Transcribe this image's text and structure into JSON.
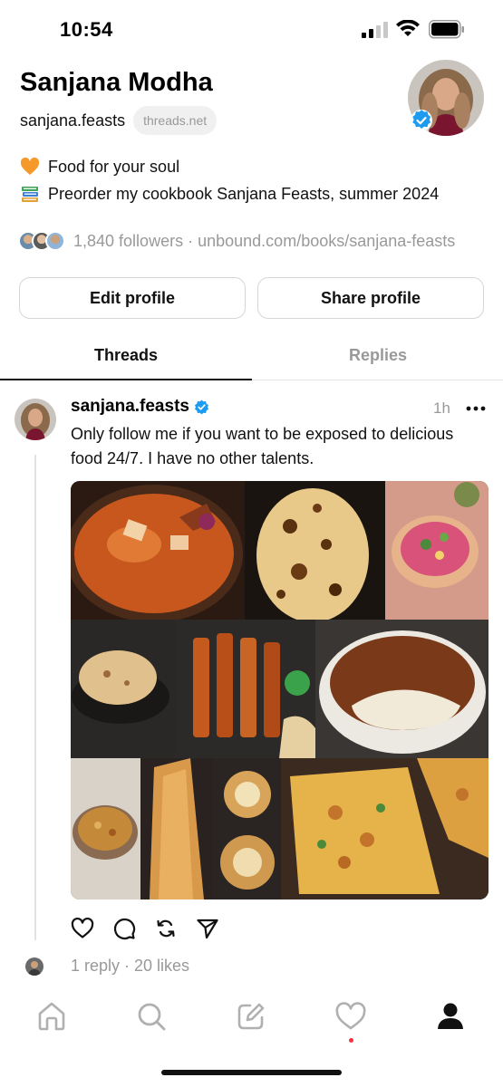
{
  "status_bar": {
    "time": "10:54"
  },
  "profile": {
    "name": "Sanjana Modha",
    "handle": "sanjana.feasts",
    "domain_badge": "threads.net",
    "bio_lines": [
      {
        "icon": "orange-heart-icon",
        "text": "Food for your soul"
      },
      {
        "icon": "books-icon",
        "text": "Preorder my cookbook Sanjana Feasts, summer 2024"
      }
    ],
    "followers_text": "1,840 followers",
    "separator": "·",
    "link_text": "unbound.com/books/sanjana-feasts",
    "edit_profile_label": "Edit profile",
    "share_profile_label": "Share profile"
  },
  "tabs": [
    {
      "label": "Threads",
      "active": true
    },
    {
      "label": "Replies",
      "active": false
    }
  ],
  "post": {
    "username": "sanjana.feasts",
    "time": "1h",
    "text": "Only follow me if you want to be exposed to delicious food 24/7. I have no other talents.",
    "photos": [
      "butter-curry",
      "naan",
      "salad-bowl",
      "roti",
      "paneer-tikka-skewers",
      "tiramisu",
      "curry-pot",
      "dosa",
      "samosas",
      "loaded-bread"
    ],
    "stats": "1 reply · 20 likes"
  },
  "bottom_nav": [
    "home-icon",
    "search-icon",
    "compose-icon",
    "activity-heart-icon",
    "profile-icon"
  ],
  "colors": {
    "accent_blue": "#1d9bf0",
    "muted_text": "#999999",
    "notification_dot": "#ff3040"
  }
}
